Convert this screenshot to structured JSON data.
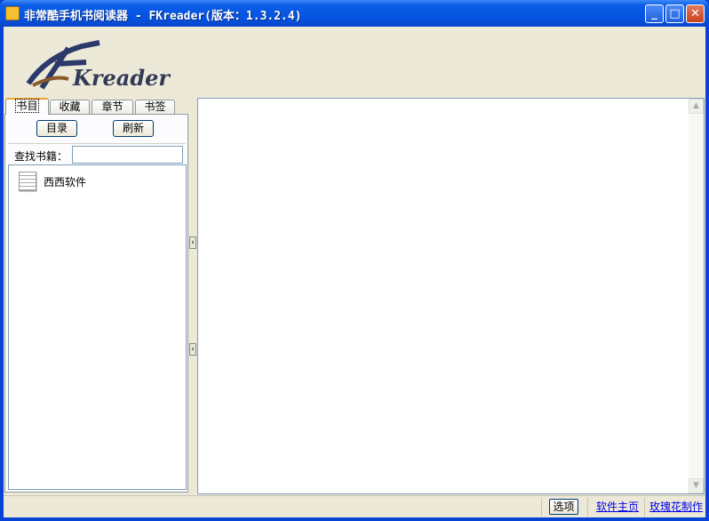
{
  "window": {
    "title": "非常酷手机书阅读器 - FKreader(版本：1.3.2.4)",
    "logo_text": "FKreader"
  },
  "tabs": [
    {
      "label": "书目",
      "active": true
    },
    {
      "label": "收藏"
    },
    {
      "label": "章节"
    },
    {
      "label": "书签"
    }
  ],
  "panel": {
    "catalog_button": "目录",
    "refresh_button": "刷新",
    "search_label": "查找书籍：",
    "search_value": ""
  },
  "books": [
    {
      "name": "西西软件",
      "icon": "text-document-icon"
    }
  ],
  "status": {
    "options_button": "选项",
    "homepage_link": "软件主页",
    "author_link": "玫瑰花制作"
  }
}
